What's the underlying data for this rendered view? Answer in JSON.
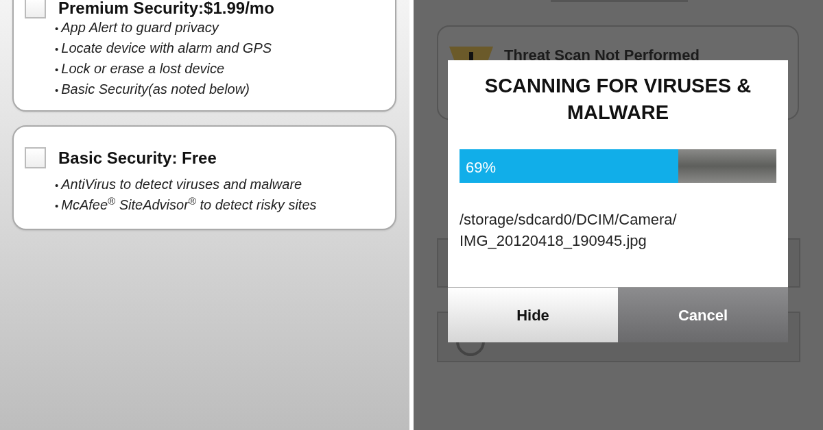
{
  "plans": [
    {
      "title": "Premium Security:$1.99/mo",
      "checked": false,
      "features": [
        {
          "bullet": "•",
          "text": "App Alert to guard privacy"
        },
        {
          "bullet": "•",
          "text": "Locate device with alarm and GPS"
        },
        {
          "bullet": "•",
          "text": "Lock or erase a lost device"
        },
        {
          "bullet": "•",
          "text": "Basic Security(as noted below)"
        }
      ]
    },
    {
      "title": "Basic Security: Free",
      "checked": false,
      "features": [
        {
          "bullet": "•",
          "text": "AntiVirus to detect viruses and malware"
        },
        {
          "bullet": "•",
          "text": "McAfee$^{®}$ SiteAdvisor$^{®}$ to detect risky sites"
        }
      ]
    }
  ],
  "background": {
    "status_title": "Threat Scan Not Performed",
    "option_selected": false
  },
  "dialog": {
    "title": "SCANNING FOR VIRUSES & MALWARE",
    "progress": {
      "level": 0.69,
      "reading": "69%"
    },
    "path": "/storage/sdcard0/DCIM/Camera/ IMG_20120418_190945.jpg",
    "buttons": [
      {
        "label": "Hide",
        "kind": "light"
      },
      {
        "label": "Cancel",
        "kind": "dark"
      }
    ]
  }
}
